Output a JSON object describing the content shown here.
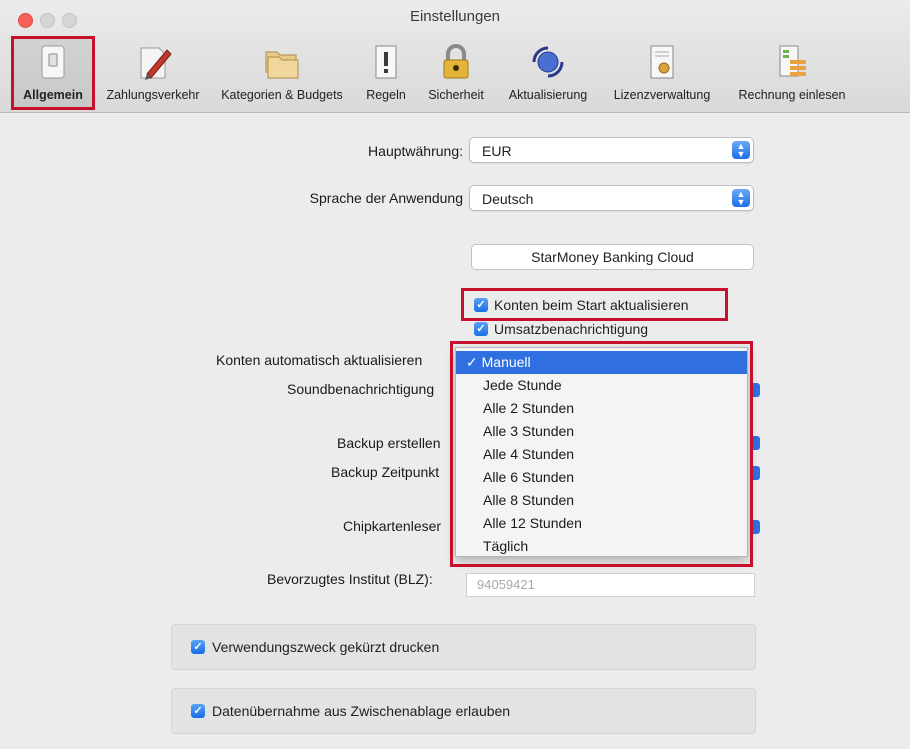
{
  "window": {
    "title": "Einstellungen"
  },
  "toolbar": {
    "items": [
      {
        "label": "Allgemein",
        "icon": "switch-icon"
      },
      {
        "label": "Zahlungsverkehr",
        "icon": "pen-document-icon"
      },
      {
        "label": "Kategorien & Budgets",
        "icon": "folders-icon"
      },
      {
        "label": "Regeln",
        "icon": "rule-document-icon"
      },
      {
        "label": "Sicherheit",
        "icon": "padlock-icon"
      },
      {
        "label": "Aktualisierung",
        "icon": "sync-globe-icon"
      },
      {
        "label": "Lizenzverwaltung",
        "icon": "certificate-icon"
      },
      {
        "label": "Rechnung einlesen",
        "icon": "invoice-scan-icon"
      }
    ],
    "selected": "Allgemein"
  },
  "form": {
    "currency_label": "Hauptwährung:",
    "currency_value": "EUR",
    "language_label": "Sprache der Anwendung",
    "language_value": "Deutsch",
    "cloud_button": "StarMoney Banking Cloud",
    "chk_update_on_start": "Konten beim Start aktualisieren",
    "chk_sales_notify": "Umsatzbenachrichtigung",
    "auto_update_label": "Konten automatisch aktualisieren",
    "sound_label": "Soundbenachrichtigung",
    "backup_label": "Backup erstellen",
    "backup_time_label": "Backup Zeitpunkt",
    "card_reader_label": "Chipkartenleser",
    "institute_label": "Bevorzugtes Institut (BLZ):",
    "institute_placeholder": "94059421",
    "chk_print_short": "Verwendungszweck gekürzt drucken",
    "chk_clipboard": "Datenübernahme aus Zwischenablage erlauben"
  },
  "dropdown": {
    "checkmark": "✓",
    "options": [
      "Manuell",
      "Jede Stunde",
      "Alle 2 Stunden",
      "Alle 3 Stunden",
      "Alle 4 Stunden",
      "Alle 6 Stunden",
      "Alle 8 Stunden",
      "Alle 12 Stunden",
      "Täglich"
    ],
    "selected": "Manuell"
  },
  "colors": {
    "accent": "#2f6fe0",
    "highlight_box": "#c8102e"
  }
}
